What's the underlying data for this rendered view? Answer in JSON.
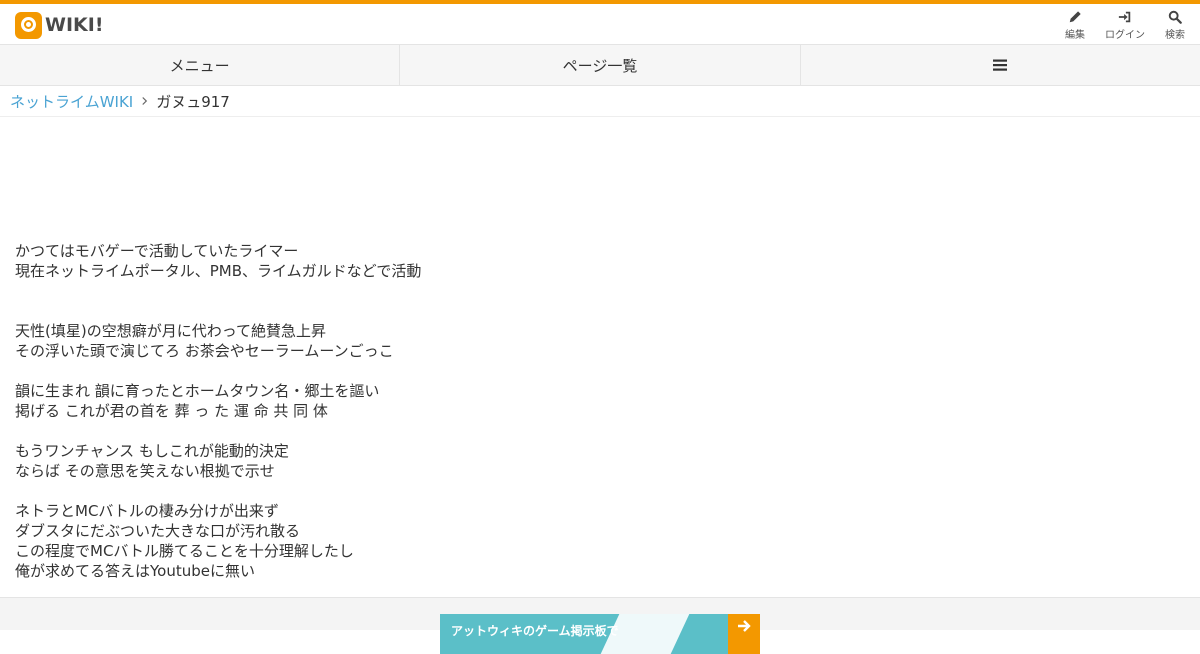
{
  "header": {
    "logo_text": "WIKI!",
    "tools": [
      {
        "label": "編集",
        "icon": "pencil-icon"
      },
      {
        "label": "ログイン",
        "icon": "login-icon"
      },
      {
        "label": "検索",
        "icon": "search-icon"
      }
    ]
  },
  "nav": {
    "menu_label": "メニュー",
    "pages_label": "ページ一覧",
    "more_icon": "hamburger-icon"
  },
  "breadcrumb": {
    "home": "ネットライムWIKI",
    "current": "ガヌュ917"
  },
  "content": {
    "lines": [
      "かつてはモバゲーで活動していたライマー",
      "現在ネットライムポータル、PMB、ライムガルドなどで活動",
      "",
      "",
      "天性(填星)の空想癖が月に代わって絶賛急上昇",
      "その浮いた頭で演じてろ お茶会やセーラームーンごっこ",
      "",
      "韻に生まれ 韻に育ったとホームタウン名・郷土を謳い",
      "掲げる これが君の首を 葬 っ た 運 命 共 同 体",
      "",
      "もうワンチャンス もしこれが能動的決定",
      "ならば その意思を笑えない根拠で示せ",
      "",
      "ネトラとMCバトルの棲み分けが出来ず",
      "ダブスタにだぶついた大きな口が汚れ散る",
      "この程度でMCバトル勝てることを十分理解したし",
      "俺が求めてる答えはYoutubeに無い"
    ]
  },
  "footer": {
    "banner_text": "アットウィキのゲーム掲示板で"
  },
  "colors": {
    "accent": "#f39800",
    "link": "#4aa3d3",
    "banner": "#5bbfc8"
  }
}
